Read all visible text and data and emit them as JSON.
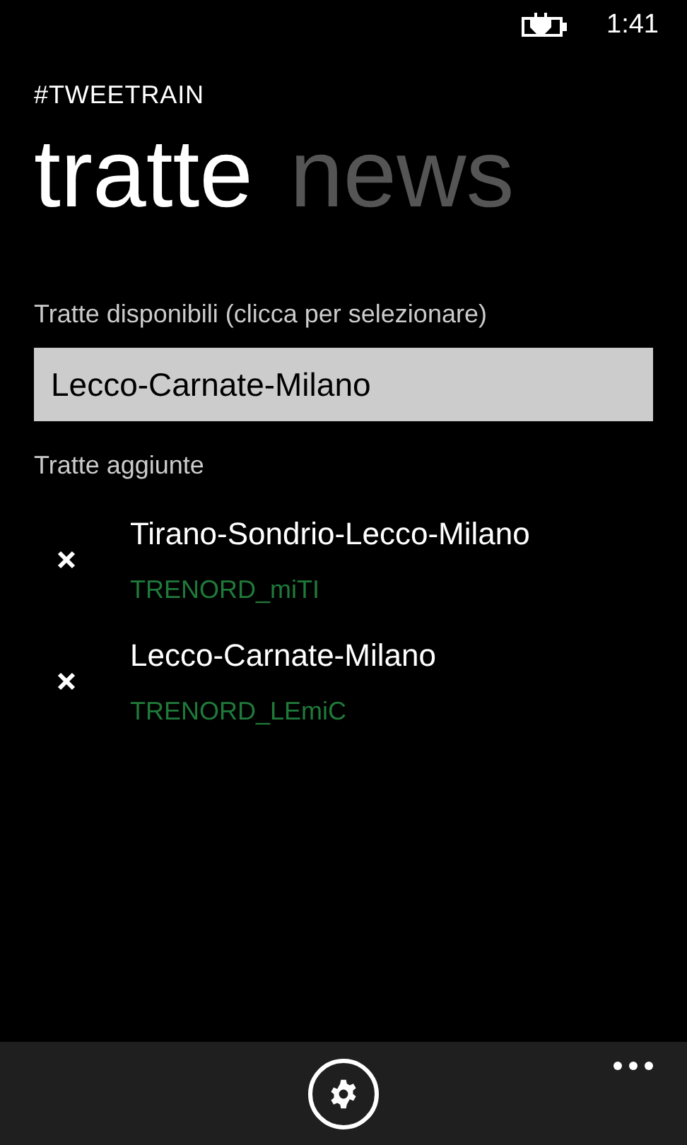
{
  "status_bar": {
    "time": "1:41"
  },
  "app_title": "#TWEETRAIN",
  "pivots": [
    {
      "label": "tratte",
      "selected": true
    },
    {
      "label": "news",
      "selected": false
    }
  ],
  "available": {
    "label": "Tratte disponibili (clicca per selezionare)",
    "value": "Lecco-Carnate-Milano"
  },
  "added": {
    "label": "Tratte aggiunte",
    "items": [
      {
        "title": "Tirano-Sondrio-Lecco-Milano",
        "account": "TRENORD_miTI"
      },
      {
        "title": "Lecco-Carnate-Milano",
        "account": "TRENORD_LEmiC"
      }
    ]
  }
}
